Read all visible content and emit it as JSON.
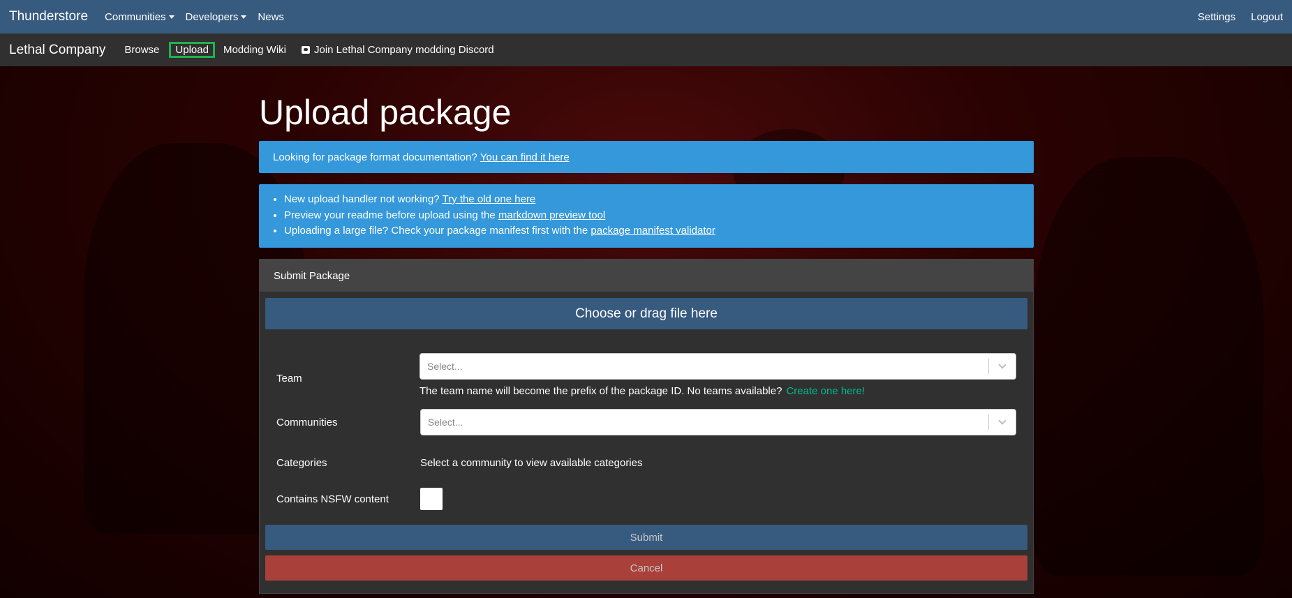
{
  "topnav": {
    "brand": "Thunderstore",
    "items": [
      {
        "label": "Communities",
        "dropdown": true
      },
      {
        "label": "Developers",
        "dropdown": true
      },
      {
        "label": "News",
        "dropdown": false
      }
    ],
    "right_items": [
      {
        "label": "Settings"
      },
      {
        "label": "Logout"
      }
    ]
  },
  "subnav": {
    "community": "Lethal Company",
    "items": [
      {
        "label": "Browse",
        "active": false
      },
      {
        "label": "Upload",
        "active": true
      },
      {
        "label": "Modding Wiki",
        "active": false
      },
      {
        "label": "Join Lethal Company modding Discord",
        "icon": "discord-icon"
      }
    ]
  },
  "page": {
    "title": "Upload package"
  },
  "alerts": {
    "docs": {
      "text": "Looking for package format documentation?",
      "link": "You can find it here"
    },
    "tips": [
      {
        "text": "New upload handler not working?",
        "link": "Try the old one here",
        "after": ""
      },
      {
        "text": "Preview your readme before upload using the",
        "link": "markdown preview tool",
        "after": ""
      },
      {
        "text": "Uploading a large file? Check your package manifest first with the",
        "link": "package manifest validator",
        "after": ""
      }
    ]
  },
  "form": {
    "header": "Submit Package",
    "dropzone": "Choose or drag file here",
    "team": {
      "label": "Team",
      "placeholder": "Select...",
      "hint": "The team name will become the prefix of the package ID. No teams available?",
      "hint_link": "Create one here!"
    },
    "communities": {
      "label": "Communities",
      "placeholder": "Select..."
    },
    "categories": {
      "label": "Categories",
      "value": "Select a community to view available categories"
    },
    "nsfw": {
      "label": "Contains NSFW content",
      "checked": false
    },
    "submit_label": "Submit",
    "cancel_label": "Cancel"
  },
  "colors": {
    "topnav": "#375a7f",
    "subnav": "#303030",
    "alert": "#3498db",
    "accent_link": "#00bc8c",
    "cancel": "#a9403a",
    "active_outline": "#22b14c"
  }
}
